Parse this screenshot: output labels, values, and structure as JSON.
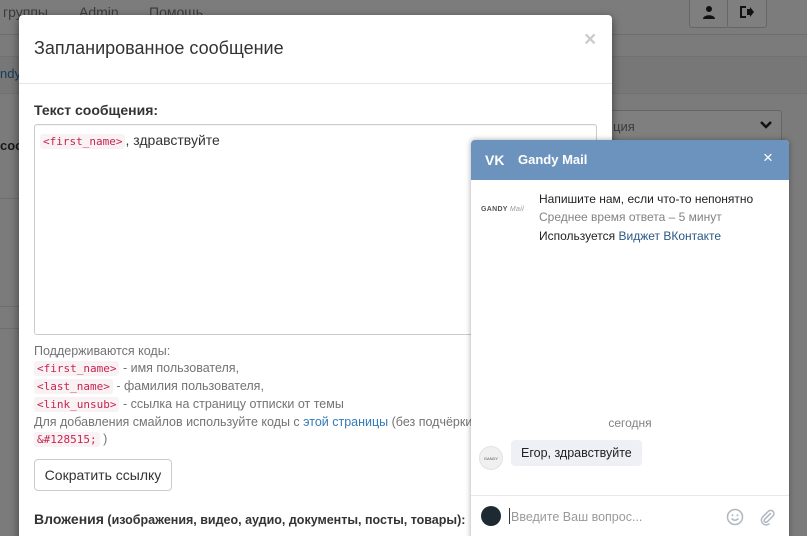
{
  "background": {
    "nav_links": [
      "группы",
      "Admin",
      "Помощь"
    ],
    "strip_text": "ndy",
    "left_text": "соо",
    "select_text": "ция"
  },
  "modal": {
    "title": "Запланированное сообщение",
    "close_glyph": "×",
    "message_label": "Текст сообщения:",
    "message_code": "<first_name>",
    "message_text": ", здравствуйте",
    "help_intro": "Поддерживаются коды:",
    "codes": [
      {
        "code": "<first_name>",
        "desc": " - имя пользователя,"
      },
      {
        "code": "<last_name>",
        "desc": " - фамилия пользователя,"
      },
      {
        "code": "<link_unsub>",
        "desc": " - ссылка на страницу отписки от темы"
      }
    ],
    "smiles_prefix": "Для добавления смайлов используйте коды с ",
    "smiles_link": "этой страницы",
    "smiles_suffix": " (без подчёркив",
    "smiles_code": "&#128515;",
    "smiles_end": " )",
    "shorten_button": "Сократить ссылку",
    "attachments_label": "Вложения",
    "attachments_sub": " (изображения, видео, аудио, документы, посты, товары):"
  },
  "vk_widget": {
    "logo_text": "VK",
    "title": "Gandy Mail",
    "close_glyph": "×",
    "brand_logo_text": "GANDY",
    "brand_logo_script": "Mail",
    "info_line1": "Напишите нам, если что-то непонятно",
    "info_line2": "Среднее время ответа – 5 минут",
    "info_line3_prefix": "Используется ",
    "info_line3_link": "Виджет ВКонтакте",
    "date_label": "сегодня",
    "message_avatar_text": "GANDY",
    "message_text": "Егор, здравствуйте",
    "input_placeholder": "Введите Ваш вопрос...",
    "colors": {
      "header": "#6c93bd",
      "link": "#2a5885",
      "muted": "#828282"
    }
  }
}
